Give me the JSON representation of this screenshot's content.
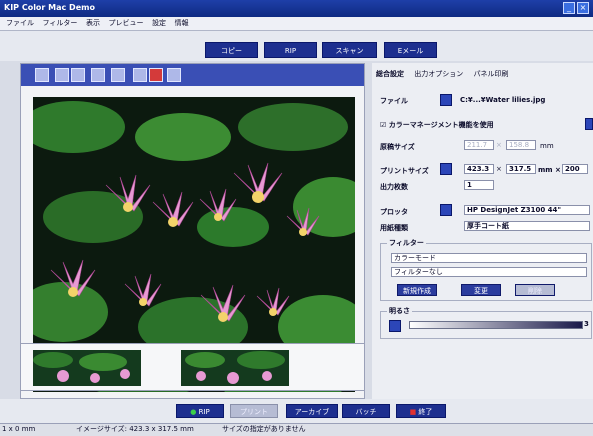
{
  "window": {
    "title": "KIP Color Mac Demo"
  },
  "menu": [
    "ファイル",
    "フィルター",
    "表示",
    "プレビュー",
    "設定",
    "情報"
  ],
  "top_buttons": [
    "コピー",
    "RIP",
    "スキャン",
    "Eメール"
  ],
  "tabs": [
    "総合設定",
    "出力オプション",
    "パネル印刷"
  ],
  "settings": {
    "file_label": "ファイル",
    "file_value": "C:¥...¥Water lilies.jpg",
    "color_mgmt_label": "カラーマネージメント機能を使用",
    "original_size_label": "原稿サイズ",
    "original_w": "211.7",
    "original_h": "158.8",
    "unit_mm": "mm",
    "print_size_label": "プリントサイズ",
    "print_w": "423.3",
    "print_h": "317.5",
    "print_extra": "200",
    "unit_mm2": "mm ×",
    "copies_label": "出力枚数",
    "copies_value": "1",
    "plotter_label": "プロッタ",
    "plotter_value": "HP DesignJet Z3100 44\"",
    "media_label": "用紙種類",
    "media_value": "厚手コート紙",
    "filter_group_label": "フィルター",
    "filter_mode": "カラーモード",
    "filter_none": "フィルターなし",
    "btn_new": "新規作成",
    "btn_change": "変更",
    "btn_delete": "削除",
    "quality_label": "明るさ",
    "quality_value": "3"
  },
  "bottom_buttons": [
    "RIP",
    "プリント",
    "アーカイブ",
    "バッチ",
    "終了"
  ],
  "status": {
    "coords": "1 x 0 mm",
    "image_size": "イメージサイズ: 423.3 x 317.5 mm",
    "message": "サイズの指定がありません"
  }
}
